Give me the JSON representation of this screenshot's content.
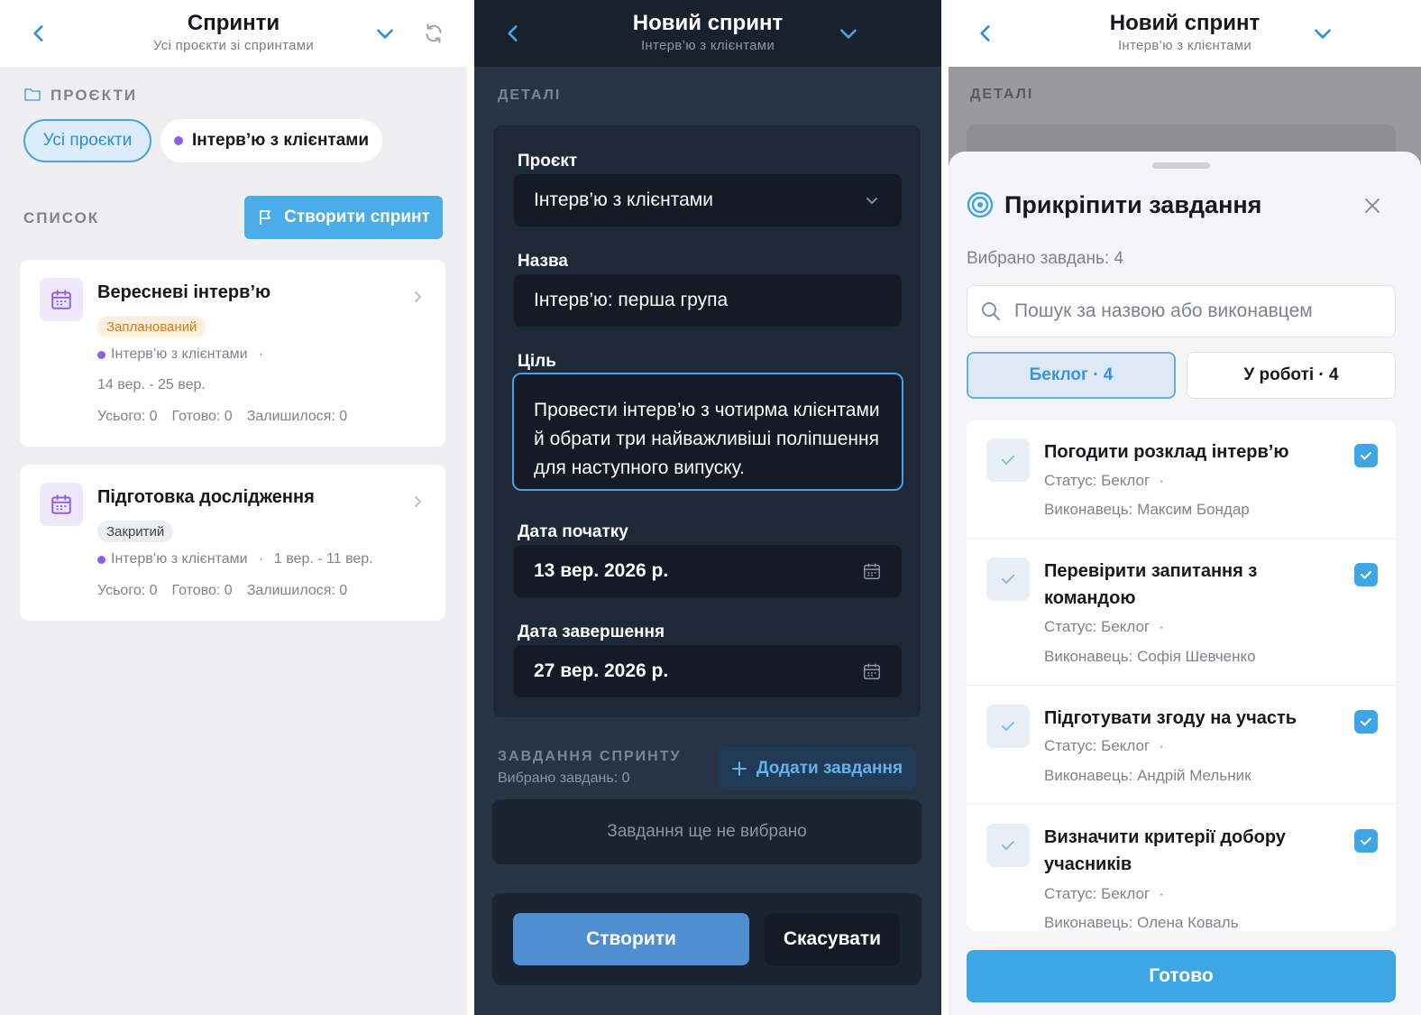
{
  "list_screen": {
    "title": "Спринти",
    "subtitle": "Усі проєкти зі спринтами",
    "projects_label": "ПРОЄКТИ",
    "filters": [
      {
        "label": "Усі проєкти"
      },
      {
        "label": "Інтерв’ю з клієнтами"
      }
    ],
    "list_label": "СПИСОК",
    "create_label": "Створити спринт",
    "sprints": [
      {
        "title": "Вересневі інтерв’ю",
        "status": "Запланований",
        "project": "Інтерв’ю з клієнтами",
        "sep": "·",
        "dates": "14 вер. - 25 вер.",
        "total": "Усього: 0",
        "done": "Готово: 0",
        "left": "Залишилося: 0"
      },
      {
        "title": "Підготовка дослідження",
        "status": "Закритий",
        "project": "Інтерв’ю з клієнтами",
        "sep": "·",
        "dates": "1 вер. - 11 вер.",
        "total": "Усього: 0",
        "done": "Готово: 0",
        "left": "Залишилося: 0"
      }
    ]
  },
  "form_screen": {
    "title": "Новий спринт",
    "subtitle": "Інтерв’ю з клієнтами",
    "details_label": "ДЕТАЛІ",
    "project_label": "Проєкт",
    "project_value": "Інтерв’ю з клієнтами",
    "name_label": "Назва",
    "name_value": "Інтерв’ю: перша група",
    "goal_label": "Ціль",
    "goal_value": "Провести інтерв’ю з чотирма клієнтами й обрати три найважливіші поліпшення для наступного випуску.",
    "start_label": "Дата початку",
    "start_value": "13 вер. 2026 р.",
    "end_label": "Дата завершення",
    "end_value": "27 вер. 2026 р.",
    "tasks_label": "ЗАВДАННЯ СПРИНТУ",
    "tasks_count": "Вибрано завдань: 0",
    "add_tasks_label": "Додати завдання",
    "empty_text": "Завдання ще не вибрано",
    "create_label": "Створити",
    "cancel_label": "Скасувати"
  },
  "attach_screen": {
    "title": "Новий спринт",
    "subtitle": "Інтерв’ю з клієнтами",
    "bg_details_label": "ДЕТАЛІ",
    "sheet_title": "Прикріпити завдання",
    "selected": "Вибрано завдань: 4",
    "search_placeholder": "Пошук за назвою або виконавцем",
    "tabs": [
      "Беклог · 4",
      "У роботі · 4"
    ],
    "tasks": [
      {
        "title": "Погодити розклад інтерв’ю",
        "status": "Статус: Беклог",
        "sep": "·",
        "assignee": "Виконавець: Максим Бондар"
      },
      {
        "title": "Перевірити запитання з командою",
        "status": "Статус: Беклог",
        "sep": "·",
        "assignee": "Виконавець: Софія Шевченко"
      },
      {
        "title": "Підготувати згоду на участь",
        "status": "Статус: Беклог",
        "sep": "·",
        "assignee": "Виконавець: Андрій Мельник"
      },
      {
        "title": "Визначити критерії добору учасників",
        "status": "Статус: Беклог",
        "sep": "·",
        "assignee": "Виконавець: Олена Коваль"
      }
    ],
    "done_label": "Готово"
  },
  "colors": {
    "accent": "#3fa6e6",
    "project_dot": "#8e5fe6",
    "dark_bg": "#263445",
    "planned_badge": "#d97b17"
  },
  "icons": [
    "back-icon",
    "chevron-down-icon",
    "refresh-icon",
    "folder-icon",
    "flag-icon",
    "calendar-icon",
    "chevron-right-icon",
    "plus-icon",
    "target-icon",
    "close-icon",
    "search-icon",
    "check-icon",
    "checkbox-icon"
  ]
}
